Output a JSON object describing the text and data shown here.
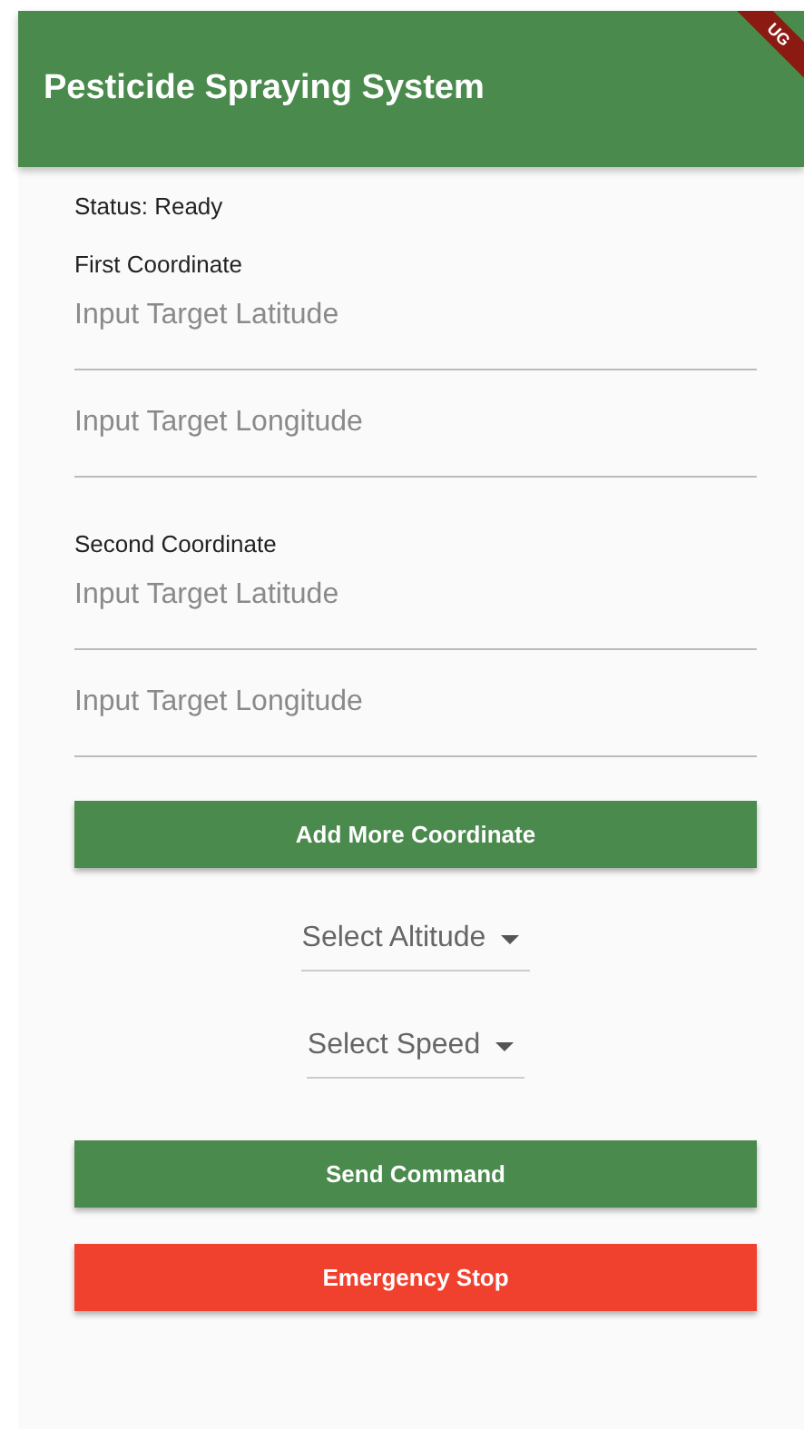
{
  "app_bar": {
    "title": "Pesticide Spraying System",
    "debug_banner": "UG"
  },
  "status": "Status: Ready",
  "coordinates": [
    {
      "label": "First Coordinate",
      "fields": [
        {
          "placeholder": "Input Target Latitude"
        },
        {
          "placeholder": "Input Target Longitude"
        }
      ]
    },
    {
      "label": "Second Coordinate",
      "fields": [
        {
          "placeholder": "Input Target Latitude"
        },
        {
          "placeholder": "Input Target Longitude"
        }
      ]
    }
  ],
  "add_button": "Add More Coordinate",
  "dropdowns": [
    {
      "label": "Select Altitude"
    },
    {
      "label": "Select Speed"
    }
  ],
  "buttons": [
    {
      "label": "Send Command",
      "kind": "primary"
    },
    {
      "label": "Emergency Stop",
      "kind": "danger"
    }
  ]
}
